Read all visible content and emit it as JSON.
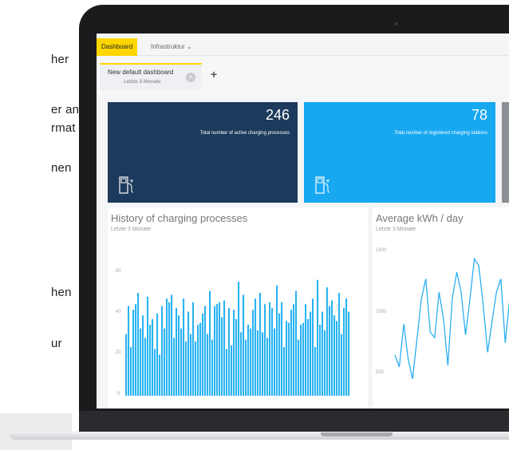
{
  "left_text": [
    "her",
    "er an",
    "rmat",
    "nen",
    "hen",
    "ur"
  ],
  "nav": {
    "tab_active": "Dashboard",
    "tab_other": "Infrastruktur",
    "tab_other_chevron": "chevron-down-icon"
  },
  "dashboard_tab": {
    "title": "New default dashboard",
    "subtitle": "Letzte 3 Monate",
    "close_icon": "close-icon",
    "add_icon": "plus-icon"
  },
  "kpis": [
    {
      "value": "246",
      "label": "Total number of active charging processes",
      "color": "#1c3b5c",
      "icon": "charging-station-icon"
    },
    {
      "value": "78",
      "label": "Total number of registered charging stations",
      "color": "#17a8f0",
      "icon": "charging-station-icon"
    }
  ],
  "panels": {
    "history": {
      "title": "History of charging processes",
      "subtitle": "Letzte 3 Monate",
      "yticks": [
        "60",
        "40",
        "20",
        "0"
      ]
    },
    "avg": {
      "title": "Average kWh / day",
      "subtitle": "Letzte 3 Monate",
      "yticks": [
        "1500",
        "1000",
        "500"
      ]
    }
  },
  "chart_data": [
    {
      "type": "bar",
      "title": "History of charging processes",
      "ylim": [
        0,
        70
      ],
      "values": [
        33,
        48,
        26,
        46,
        49,
        55,
        36,
        43,
        31,
        53,
        38,
        41,
        25,
        44,
        22,
        48,
        36,
        52,
        50,
        54,
        31,
        47,
        43,
        36,
        52,
        29,
        45,
        33,
        50,
        29,
        38,
        39,
        44,
        48,
        33,
        56,
        30,
        48,
        49,
        50,
        42,
        51,
        25,
        47,
        27,
        46,
        41,
        61,
        34,
        54,
        30,
        38,
        36,
        46,
        52,
        35,
        55,
        34,
        49,
        31,
        50,
        47,
        36,
        59,
        44,
        50,
        26,
        40,
        39,
        46,
        49,
        56,
        30,
        38,
        39,
        49,
        41,
        45,
        52,
        26,
        62,
        38,
        45,
        35,
        58,
        48,
        51,
        43,
        40,
        55,
        33,
        47,
        52,
        45
      ],
      "color": "#29b3f2"
    },
    {
      "type": "line",
      "title": "Average kWh / day",
      "ylim": [
        400,
        1500
      ],
      "values": [
        730,
        640,
        960,
        700,
        550,
        850,
        1150,
        1300,
        900,
        860,
        1200,
        1000,
        650,
        1150,
        1350,
        1200,
        880,
        1150,
        1450,
        1400,
        1100,
        750,
        980,
        1200,
        1300,
        820,
        1150,
        1400,
        1360,
        1200,
        880
      ],
      "color": "#2aaef0"
    }
  ]
}
